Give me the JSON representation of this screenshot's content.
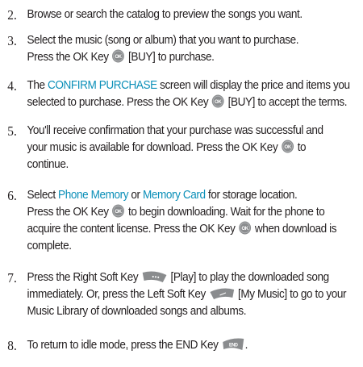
{
  "steps": [
    {
      "number": "2.",
      "line1": "Browse or search the catalog to preview the songs you want."
    },
    {
      "number": "3.",
      "line1": "Select the music (song or album) that you want to purchase.",
      "line2_a": "Press the OK Key",
      "line2_b": "[BUY] to purchase."
    },
    {
      "number": "4.",
      "line1_a": "The",
      "line1_hl": "CONFIRM PURCHASE",
      "line1_b": "screen will display the price and items you",
      "line2_a": "selected to purchase. Press the OK Key",
      "line2_b": "[BUY] to accept the terms."
    },
    {
      "number": "5.",
      "line1": "You'll receive confirmation that your purchase was successful and",
      "line2_a": "your music is available for download. Press the OK Key",
      "line2_b": "to",
      "line3": "continue."
    },
    {
      "number": "6.",
      "line1_a": "Select",
      "line1_hl1": "Phone Memory",
      "line1_or": "or",
      "line1_hl2": "Memory Card",
      "line1_b": "for storage location.",
      "line2_a": "Press the OK Key",
      "line2_b": "to begin downloading. Wait for the phone to",
      "line3_a": "acquire the content license. Press the OK Key",
      "line3_b": "when download is",
      "line4": "complete."
    },
    {
      "number": "7.",
      "line1_a": "Press the Right Soft Key",
      "line1_b": "[Play] to play the downloaded song",
      "line2_a": "immediately. Or, press the Left Soft Key",
      "line2_b": "[My Music] to go to your",
      "line3": "Music Library of downloaded songs and albums."
    },
    {
      "number": "8.",
      "line1_a": "To return to idle mode, press the END Key",
      "line1_b": "."
    }
  ],
  "keys": {
    "ok_label": "OK",
    "end_label": "END"
  },
  "colors": {
    "text": "#231f20",
    "highlight": "#0b8fb8",
    "key_fill": "#8a8c8e"
  }
}
